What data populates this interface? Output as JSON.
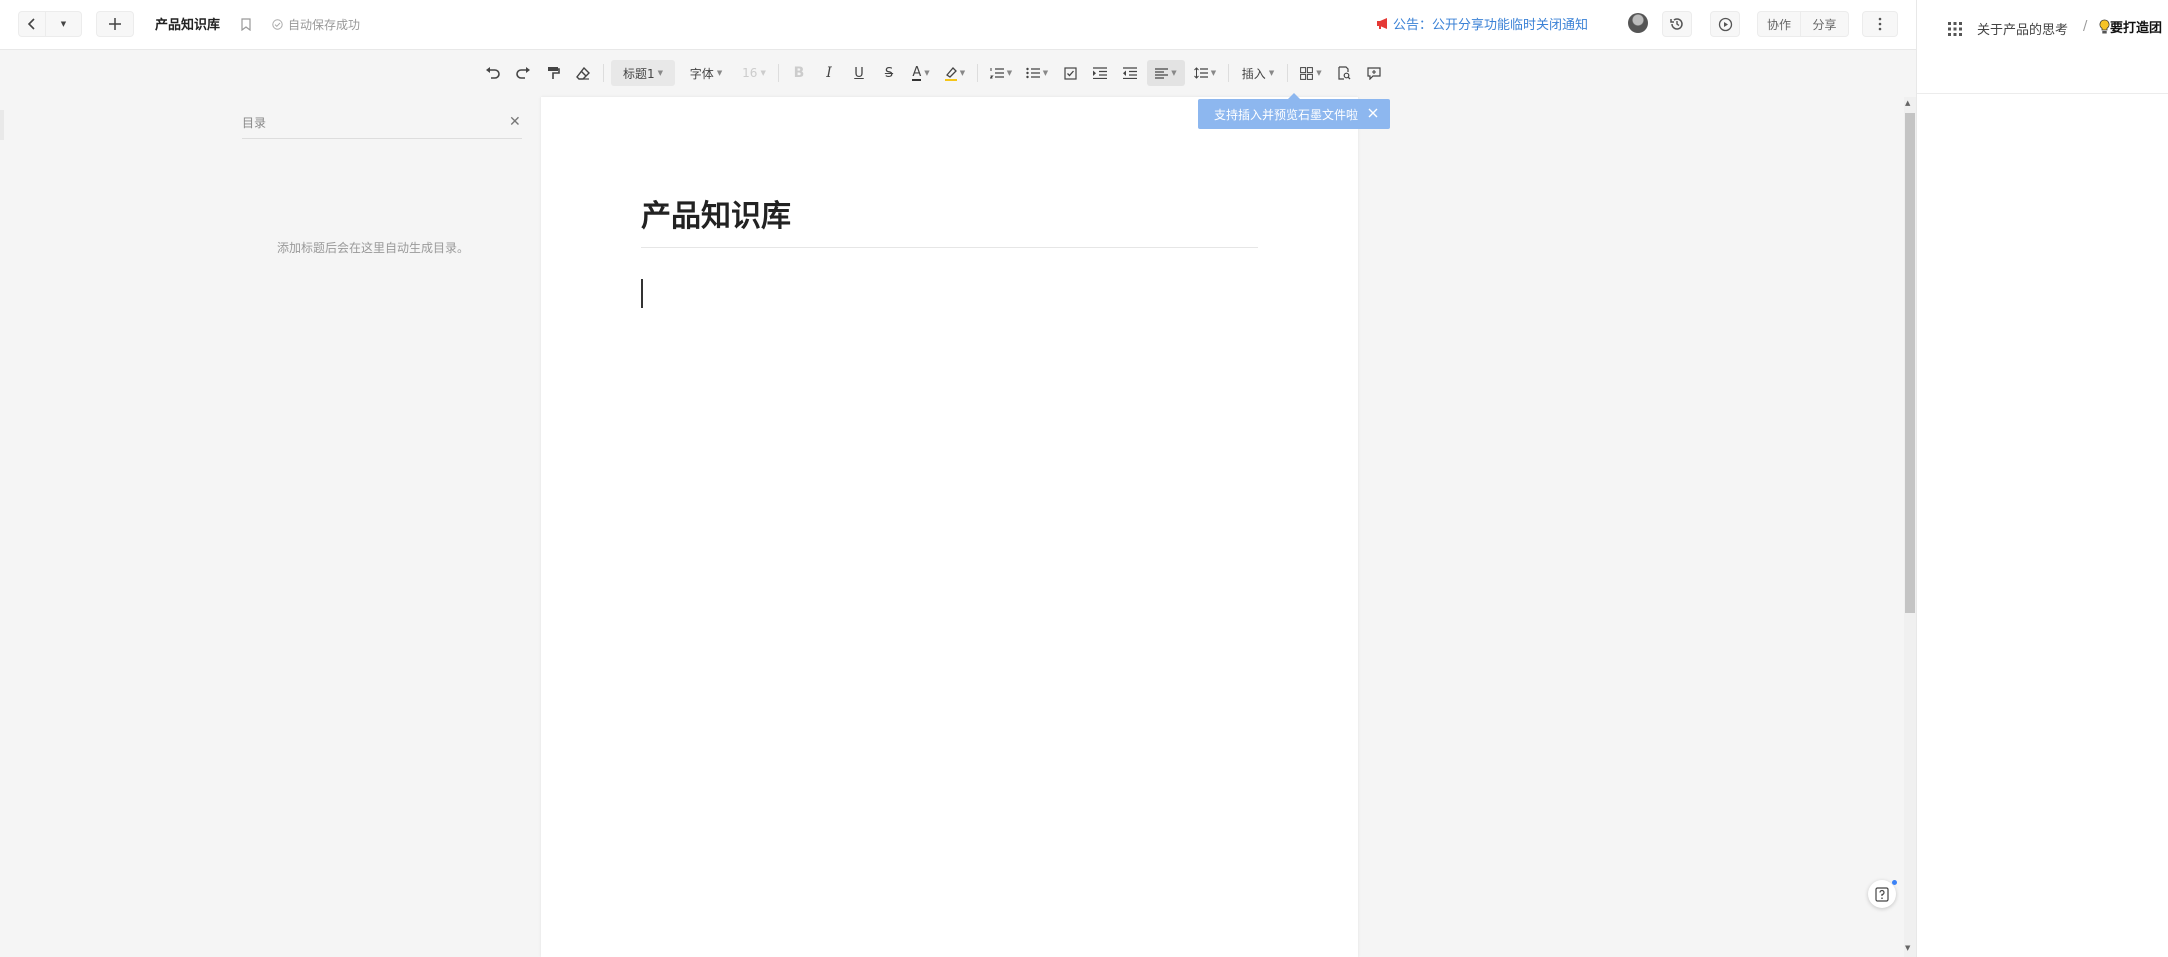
{
  "header": {
    "doc_title": "产品知识库",
    "autosave": "自动保存成功",
    "notice_prefix": "公告：",
    "notice_text": "公开分享功能临时关闭通知",
    "collab_label": "协作",
    "share_label": "分享"
  },
  "breadcrumb": {
    "parent": "关于产品的思考",
    "separator": "/",
    "current": "要打造团"
  },
  "toolbar": {
    "heading_select": "标题1",
    "font_select": "字体",
    "size_select": "16",
    "insert_label": "插入"
  },
  "outline": {
    "title": "目录",
    "empty_hint": "添加标题后会在这里自动生成目录。"
  },
  "page": {
    "title": "产品知识库"
  },
  "tooltip": {
    "text": "支持插入并预览石墨文件啦"
  },
  "colors": {
    "accent_blue": "#3b82d6",
    "tooltip_bg": "#8db7ef",
    "notice_icon": "#e53935"
  }
}
